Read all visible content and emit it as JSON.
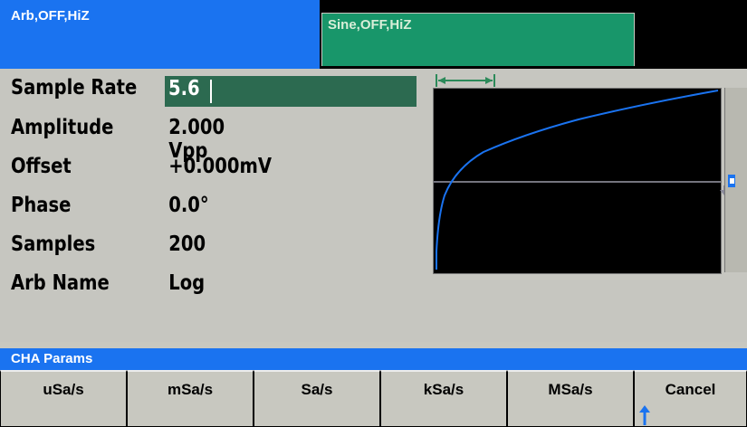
{
  "channels": {
    "ch1_status": "Arb,OFF,HiZ",
    "ch2_status": "Sine,OFF,HiZ"
  },
  "params": {
    "sample_rate": {
      "label": "Sample Rate",
      "value": "5.6"
    },
    "amplitude": {
      "label": "Amplitude",
      "value": "2.000 Vpp"
    },
    "offset": {
      "label": "Offset",
      "value": "+0.000mV"
    },
    "phase": {
      "label": "Phase",
      "value": "0.0°"
    },
    "samples": {
      "label": "Samples",
      "value": "200"
    },
    "arb_name": {
      "label": "Arb Name",
      "value": "Log"
    }
  },
  "status_bar": {
    "title": "CHA Params"
  },
  "softkeys": [
    "uSa/s",
    "mSa/s",
    "Sa/s",
    "kSa/s",
    "MSa/s",
    "Cancel"
  ],
  "colors": {
    "ch1_tab": "#1a73f0",
    "ch2_tab": "#18966a",
    "highlight": "#2c6a50",
    "waveform": "#1a73f0",
    "period_marker": "#2c8a5a"
  },
  "icons": {
    "period_marker": "double-arrow-horizontal-icon",
    "trigger_marker": "arrow-down-icon",
    "return_arrow": "arrow-up-icon"
  }
}
